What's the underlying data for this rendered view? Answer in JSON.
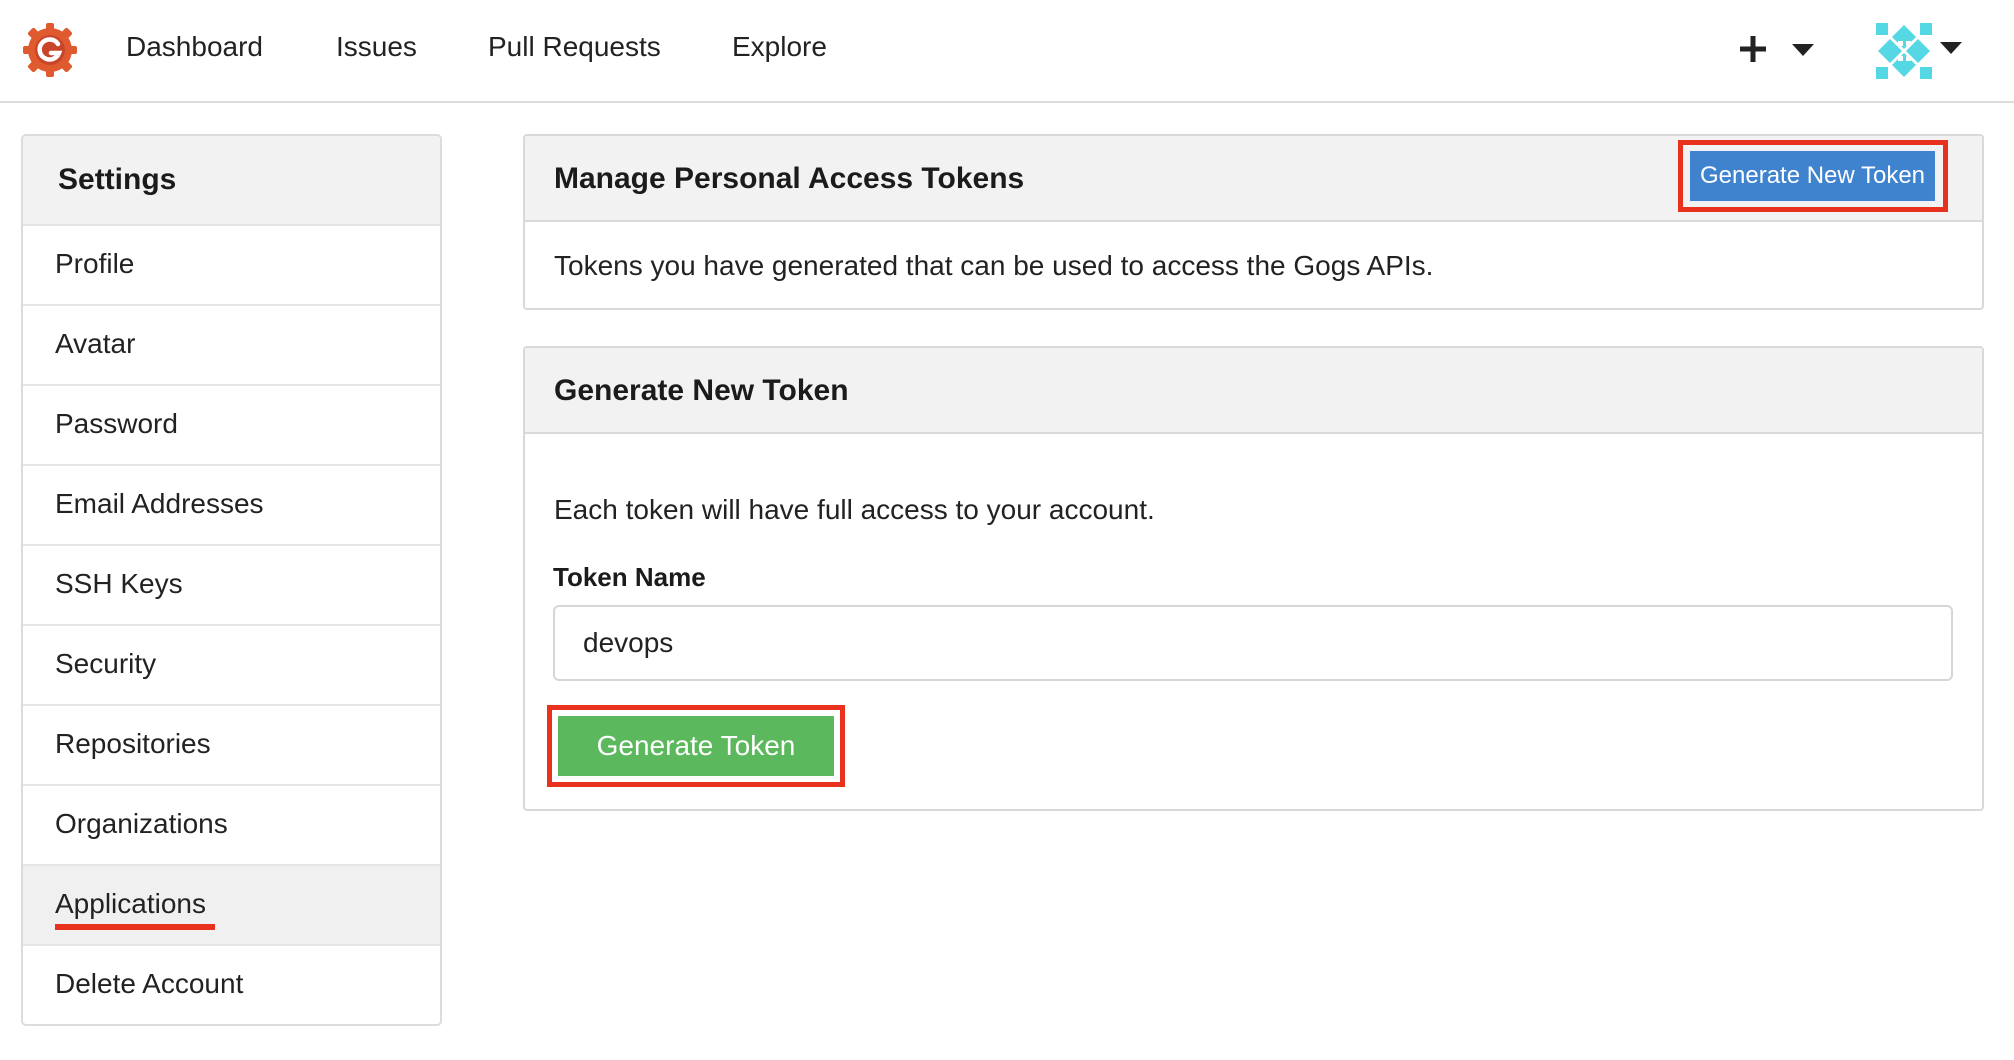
{
  "nav": {
    "logo_icon": "gogs-logo-icon",
    "links": [
      "Dashboard",
      "Issues",
      "Pull Requests",
      "Explore"
    ],
    "create_icon": "plus-icon",
    "avatar_icon": "avatar-icon"
  },
  "sidebar": {
    "title": "Settings",
    "items": [
      {
        "label": "Profile"
      },
      {
        "label": "Avatar"
      },
      {
        "label": "Password"
      },
      {
        "label": "Email Addresses"
      },
      {
        "label": "SSH Keys"
      },
      {
        "label": "Security"
      },
      {
        "label": "Repositories"
      },
      {
        "label": "Organizations"
      },
      {
        "label": "Applications",
        "active": true
      },
      {
        "label": "Delete Account"
      }
    ]
  },
  "tokens_panel": {
    "title": "Manage Personal Access Tokens",
    "button_label": "Generate New Token",
    "description": "Tokens you have generated that can be used to access the Gogs APIs."
  },
  "generate_panel": {
    "title": "Generate New Token",
    "description": "Each token will have full access to your account.",
    "field_label": "Token Name",
    "field_value": "devops",
    "submit_label": "Generate Token"
  },
  "colors": {
    "primary_button": "#3f83cf",
    "success_button": "#5cb85c",
    "highlight": "#e8321e",
    "logo": "#e05a2f",
    "avatar": "#55d8e4"
  }
}
